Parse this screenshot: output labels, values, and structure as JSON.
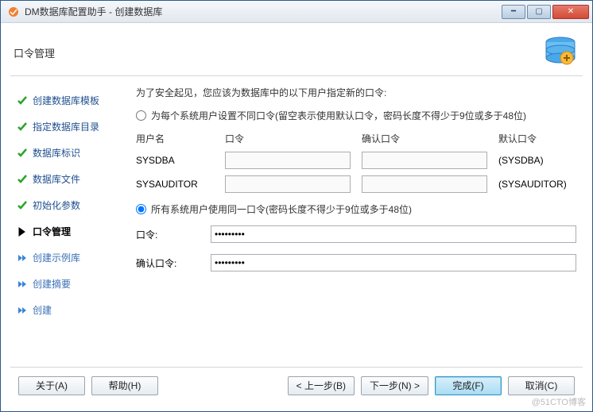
{
  "window": {
    "title": "DM数据库配置助手 - 创建数据库"
  },
  "section": {
    "title": "口令管理"
  },
  "sidebar": {
    "items": [
      {
        "label": "创建数据库模板",
        "state": "done"
      },
      {
        "label": "指定数据库目录",
        "state": "done"
      },
      {
        "label": "数据库标识",
        "state": "done"
      },
      {
        "label": "数据库文件",
        "state": "done"
      },
      {
        "label": "初始化参数",
        "state": "done"
      },
      {
        "label": "口令管理",
        "state": "current"
      },
      {
        "label": "创建示例库",
        "state": "pending"
      },
      {
        "label": "创建摘要",
        "state": "pending"
      },
      {
        "label": "创建",
        "state": "pending"
      }
    ]
  },
  "main": {
    "instruction": "为了安全起见，您应该为数据库中的以下用户指定新的口令:",
    "radio1": "为每个系统用户设置不同口令(留空表示使用默认口令，密码长度不得少于9位或多于48位)",
    "radio2": "所有系统用户使用同一口令(密码长度不得少于9位或多于48位)",
    "selected_option": "same",
    "headers": {
      "user": "用户名",
      "pwd": "口令",
      "confirm": "确认口令",
      "default": "默认口令"
    },
    "rows": [
      {
        "user": "SYSDBA",
        "pwd": "",
        "confirm": "",
        "default": "(SYSDBA)"
      },
      {
        "user": "SYSAUDITOR",
        "pwd": "",
        "confirm": "",
        "default": "(SYSAUDITOR)"
      }
    ],
    "same": {
      "pwd_label": "口令:",
      "confirm_label": "确认口令:",
      "pwd_value": "•••••••••",
      "confirm_value": "•••••••••"
    }
  },
  "footer": {
    "about": "关于(A)",
    "help": "帮助(H)",
    "back": "< 上一步(B)",
    "next": "下一步(N) >",
    "finish": "完成(F)",
    "cancel": "取消(C)"
  },
  "watermark": "@51CTO博客"
}
